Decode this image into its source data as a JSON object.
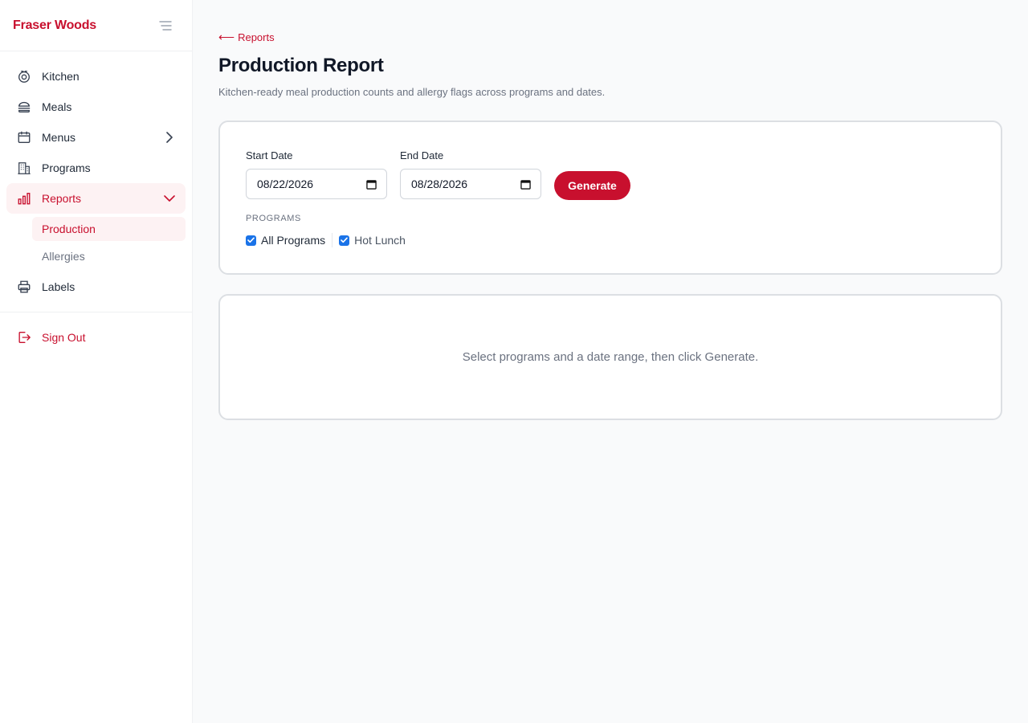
{
  "sidebar": {
    "brand": "Fraser Woods",
    "items": [
      {
        "label": "Kitchen",
        "icon": "kitchen-icon"
      },
      {
        "label": "Meals",
        "icon": "meals-icon"
      },
      {
        "label": "Menus",
        "icon": "calendar-icon"
      },
      {
        "label": "Programs",
        "icon": "building-icon"
      },
      {
        "label": "Reports",
        "icon": "bar-chart-icon"
      },
      {
        "label": "Labels",
        "icon": "printer-icon"
      }
    ],
    "reports_subitems": [
      {
        "label": "Production",
        "active": true
      },
      {
        "label": "Allergies",
        "active": false
      }
    ],
    "sign_out": "Sign Out"
  },
  "header": {
    "back_label": "Reports",
    "title": "Production Report",
    "subtitle": "Kitchen-ready meal production counts and allergy flags across programs and dates."
  },
  "filters": {
    "start_date_label": "Start Date",
    "start_date_value": "08/22/2026",
    "end_date_label": "End Date",
    "end_date_value": "08/28/2026",
    "generate_label": "Generate",
    "programs_label": "PROGRAMS",
    "programs": [
      {
        "label": "All Programs",
        "checked": true
      },
      {
        "label": "Hot Lunch",
        "checked": true
      }
    ]
  },
  "results": {
    "empty_message": "Select programs and a date range, then click Generate."
  },
  "colors": {
    "accent": "#c8102e",
    "active_bg": "#fdf2f3",
    "checkbox": "#1a73e8"
  }
}
